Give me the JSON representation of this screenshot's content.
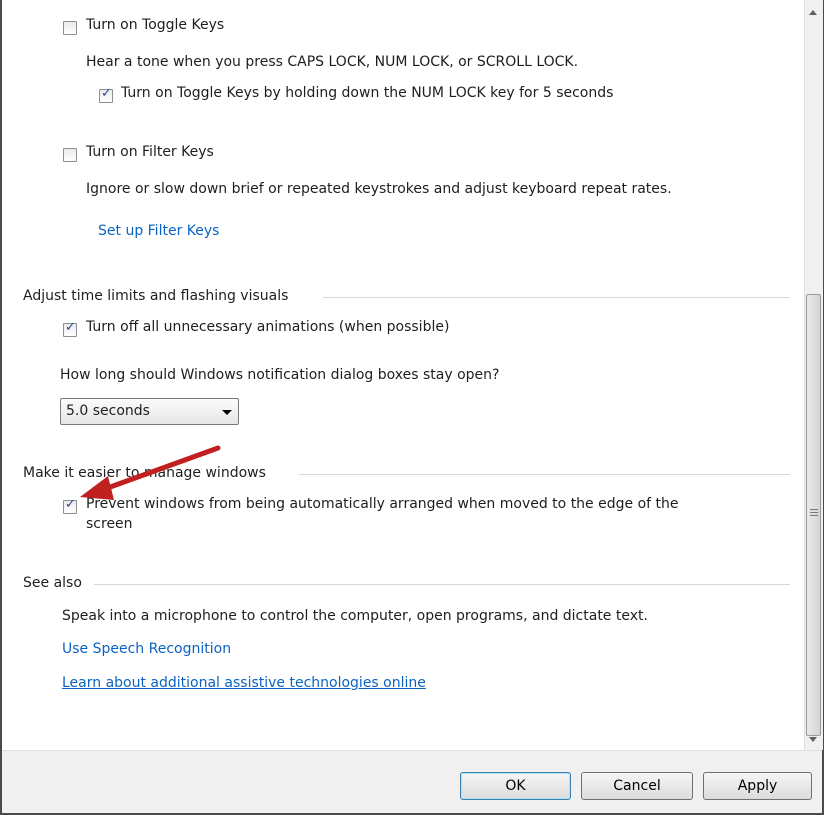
{
  "settings": {
    "toggle_keys": {
      "label": "Turn on Toggle Keys",
      "checked": false,
      "description": "Hear a tone when you press CAPS LOCK, NUM LOCK, or SCROLL LOCK.",
      "sub_option_label": "Turn on Toggle Keys by holding down the NUM LOCK key for 5 seconds",
      "sub_option_checked": true
    },
    "filter_keys": {
      "label": "Turn on Filter Keys",
      "checked": false,
      "description": "Ignore or slow down brief or repeated keystrokes and adjust keyboard repeat rates.",
      "setup_link": "Set up Filter Keys"
    },
    "time_limits": {
      "heading": "Adjust time limits and flashing visuals",
      "animations_label": "Turn off all unnecessary animations (when possible)",
      "animations_checked": true,
      "notification_question": "How long should Windows notification dialog boxes stay open?",
      "notification_selected": "5.0 seconds"
    },
    "manage_windows": {
      "heading": "Make it easier to manage windows",
      "prevent_arrange_line1": "Prevent windows from being automatically arranged when moved to the edge of the",
      "prevent_arrange_line2": "screen",
      "prevent_arrange_checked": true
    },
    "see_also": {
      "heading": "See also",
      "speech_description": "Speak into a microphone to control the computer, open programs, and dictate text.",
      "speech_link": "Use Speech Recognition",
      "assistive_link": "Learn about additional assistive technologies online"
    }
  },
  "footer": {
    "ok_label": "OK",
    "cancel_label": "Cancel",
    "apply_label": "Apply"
  },
  "colors": {
    "link": "#0a63c1",
    "annotation_arrow": "#c0201f"
  },
  "icons": [
    "checkbox-unchecked",
    "checkbox-checked",
    "dropdown-arrow",
    "scroll-up-arrow",
    "scroll-down-arrow",
    "red-arrow-annotation"
  ]
}
